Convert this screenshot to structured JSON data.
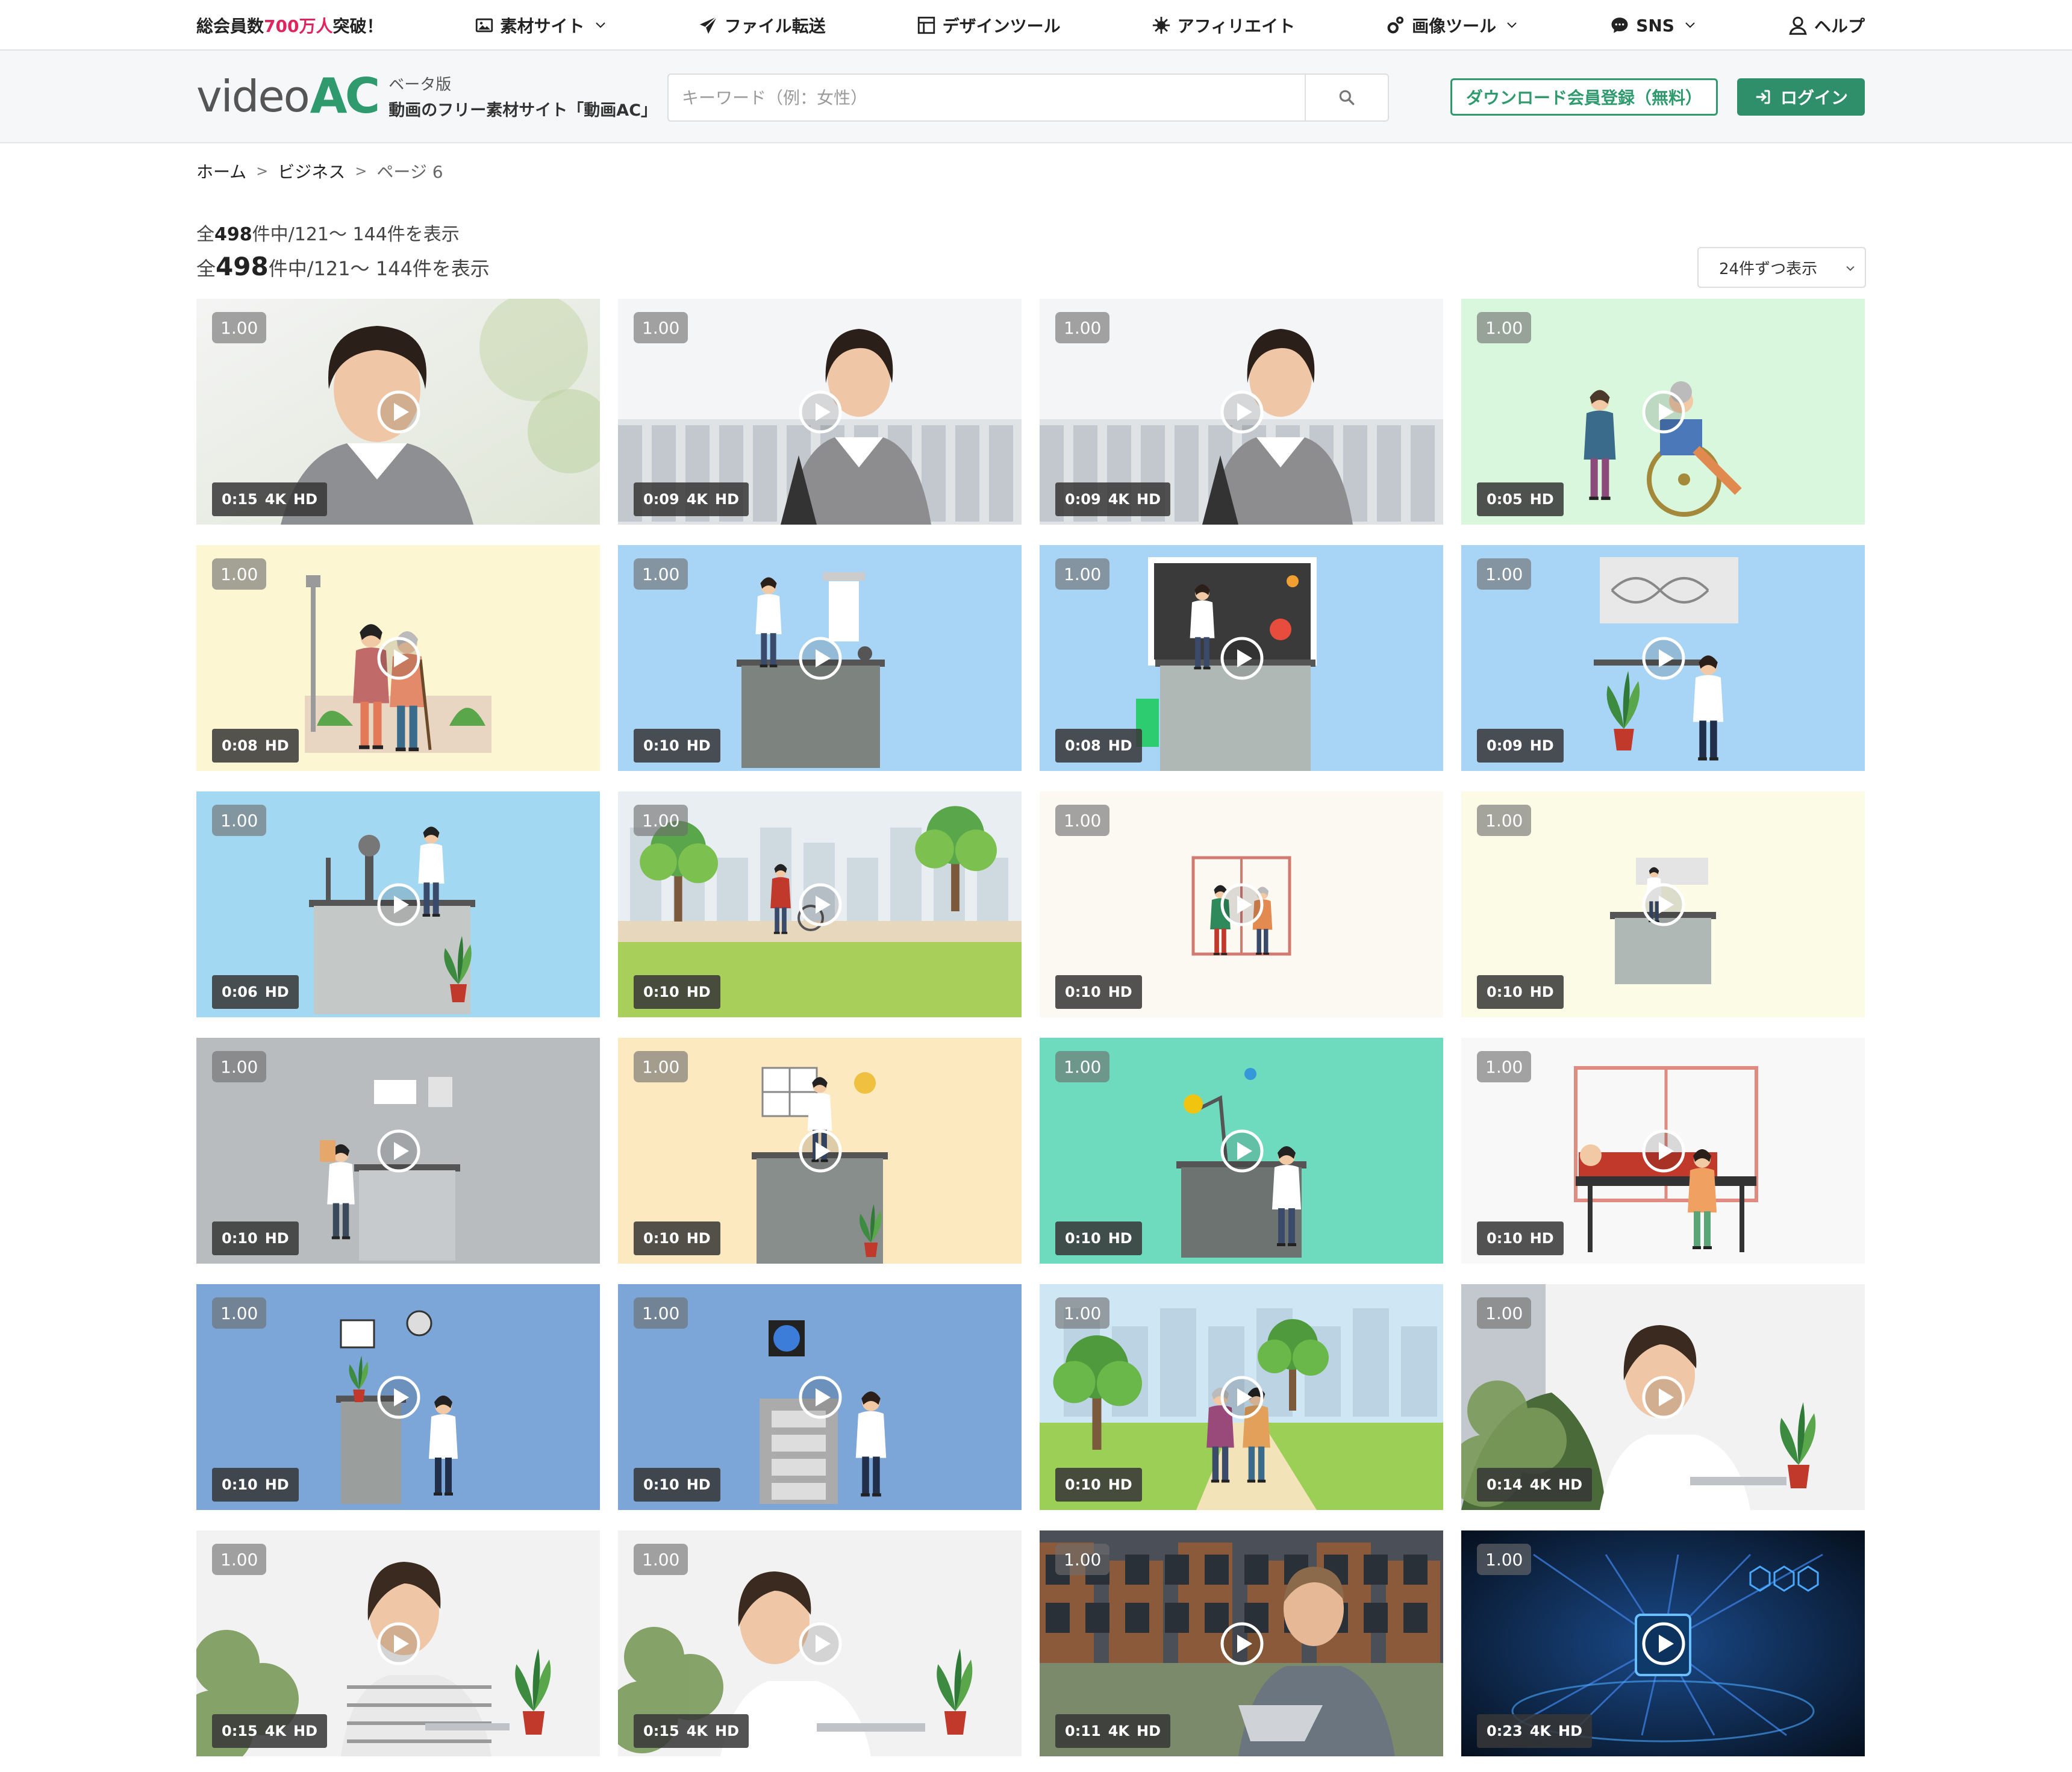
{
  "topnav": {
    "members_prefix": "総会員数",
    "members_count": "700万人",
    "members_suffix": "突破！",
    "items": [
      {
        "label": "素材サイト",
        "icon": "image-icon",
        "dropdown": true
      },
      {
        "label": "ファイル転送",
        "icon": "paper-plane-icon",
        "dropdown": false
      },
      {
        "label": "デザインツール",
        "icon": "layout-icon",
        "dropdown": false
      },
      {
        "label": "アフィリエイト",
        "icon": "virus-icon",
        "dropdown": false
      },
      {
        "label": "画像ツール",
        "icon": "gears-icon",
        "dropdown": true
      },
      {
        "label": "SNS",
        "icon": "chat-bubble-icon",
        "dropdown": true
      },
      {
        "label": "ヘルプ",
        "icon": "user-help-icon",
        "dropdown": false
      }
    ]
  },
  "header": {
    "logo_word": "video",
    "logo_ac": "AC",
    "beta": "ベータ版",
    "tagline": "動画のフリー素材サイト「動画AC」",
    "search_placeholder": "キーワード（例：女性）",
    "register_label": "ダウンロード会員登録（無料）",
    "login_label": "ログイン"
  },
  "breadcrumb": {
    "items": [
      "ホーム",
      "ビジネス"
    ],
    "separator": ">",
    "current": "ページ 6"
  },
  "results": {
    "prefix": "全",
    "total": "498",
    "suffix": "件中/121～ 144件を表示"
  },
  "per_page": "24件ずつ表示",
  "colors": {
    "brand_green": "#2e9a6e",
    "highlight_red": "#e0245e"
  },
  "videos": [
    {
      "score": "1.00",
      "duration": "0:15",
      "res4k": "4K",
      "hd": "HD",
      "scene": "photo-woman-smiling"
    },
    {
      "score": "1.00",
      "duration": "0:09",
      "res4k": "4K",
      "hd": "HD",
      "scene": "photo-businesswoman"
    },
    {
      "score": "1.00",
      "duration": "0:09",
      "res4k": "4K",
      "hd": "HD",
      "scene": "photo-businesswoman"
    },
    {
      "score": "1.00",
      "duration": "0:05",
      "res4k": "",
      "hd": "HD",
      "scene": "wheelchair-care"
    },
    {
      "score": "1.00",
      "duration": "0:08",
      "res4k": "",
      "hd": "HD",
      "scene": "elderly-walk"
    },
    {
      "score": "1.00",
      "duration": "0:10",
      "res4k": "",
      "hd": "HD",
      "scene": "lab-scientist"
    },
    {
      "score": "1.00",
      "duration": "0:08",
      "res4k": "",
      "hd": "HD",
      "scene": "lab-blackboard"
    },
    {
      "score": "1.00",
      "duration": "0:09",
      "res4k": "",
      "hd": "HD",
      "scene": "lab-dna"
    },
    {
      "score": "1.00",
      "duration": "0:06",
      "res4k": "",
      "hd": "HD",
      "scene": "lab-microscope"
    },
    {
      "score": "1.00",
      "duration": "0:10",
      "res4k": "",
      "hd": "HD",
      "scene": "park-wheelchair"
    },
    {
      "score": "1.00",
      "duration": "0:10",
      "res4k": "",
      "hd": "HD",
      "scene": "small-care-window"
    },
    {
      "score": "1.00",
      "duration": "0:10",
      "res4k": "",
      "hd": "HD",
      "scene": "small-lab"
    },
    {
      "score": "1.00",
      "duration": "0:10",
      "res4k": "",
      "hd": "HD",
      "scene": "lab-clipboard"
    },
    {
      "score": "1.00",
      "duration": "0:10",
      "res4k": "",
      "hd": "HD",
      "scene": "lab-window"
    },
    {
      "score": "1.00",
      "duration": "0:10",
      "res4k": "",
      "hd": "HD",
      "scene": "lab-flask"
    },
    {
      "score": "1.00",
      "duration": "0:10",
      "res4k": "",
      "hd": "HD",
      "scene": "massage"
    },
    {
      "score": "1.00",
      "duration": "0:10",
      "res4k": "",
      "hd": "HD",
      "scene": "lab-clock"
    },
    {
      "score": "1.00",
      "duration": "0:10",
      "res4k": "",
      "hd": "HD",
      "scene": "lab-cabinet"
    },
    {
      "score": "1.00",
      "duration": "0:10",
      "res4k": "",
      "hd": "HD",
      "scene": "park-elderly"
    },
    {
      "score": "1.00",
      "duration": "0:14",
      "res4k": "4K",
      "hd": "HD",
      "scene": "photo-laptop-woman"
    },
    {
      "score": "1.00",
      "duration": "0:15",
      "res4k": "4K",
      "hd": "HD",
      "scene": "photo-phone-woman"
    },
    {
      "score": "1.00",
      "duration": "0:15",
      "res4k": "4K",
      "hd": "HD",
      "scene": "photo-laptop-woman2"
    },
    {
      "score": "1.00",
      "duration": "0:11",
      "res4k": "4K",
      "hd": "HD",
      "scene": "photo-businessman"
    },
    {
      "score": "1.00",
      "duration": "0:23",
      "res4k": "4K",
      "hd": "HD",
      "scene": "tech-circuit"
    }
  ]
}
